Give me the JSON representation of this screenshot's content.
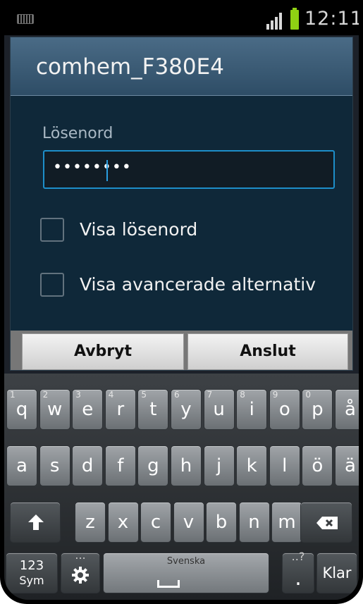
{
  "status": {
    "time": "12:11",
    "battery_color": "#8fd113"
  },
  "dialog": {
    "title": "comhem_F380E4",
    "password_label": "Lösenord",
    "password_value": "••••••••",
    "show_password_label": "Visa lösenord",
    "show_advanced_label": "Visa avancerade alternativ",
    "cancel_label": "Avbryt",
    "connect_label": "Anslut"
  },
  "keyboard": {
    "row1": [
      {
        "key": "q",
        "num": "1"
      },
      {
        "key": "w",
        "num": "2"
      },
      {
        "key": "e",
        "num": "3"
      },
      {
        "key": "r",
        "num": "4"
      },
      {
        "key": "t",
        "num": "5"
      },
      {
        "key": "y",
        "num": "6"
      },
      {
        "key": "u",
        "num": "7"
      },
      {
        "key": "i",
        "num": "8"
      },
      {
        "key": "o",
        "num": "9"
      },
      {
        "key": "p",
        "num": "0"
      },
      {
        "key": "å",
        "num": ""
      }
    ],
    "row2": [
      "a",
      "s",
      "d",
      "f",
      "g",
      "h",
      "j",
      "k",
      "l",
      "ö",
      "ä"
    ],
    "row3": [
      "z",
      "x",
      "c",
      "v",
      "b",
      "n",
      "m"
    ],
    "sym_label_top": "123",
    "sym_label_bottom": "Sym",
    "settings_hint": "...",
    "space_label": "Svenska",
    "period_label": ".",
    "period_hint": "..?",
    "done_label": "Klar",
    "icons": [
      "keyboard-status-icon",
      "signal-icon",
      "battery-icon",
      "shift-icon",
      "backspace-icon",
      "gear-icon",
      "space-icon"
    ]
  }
}
